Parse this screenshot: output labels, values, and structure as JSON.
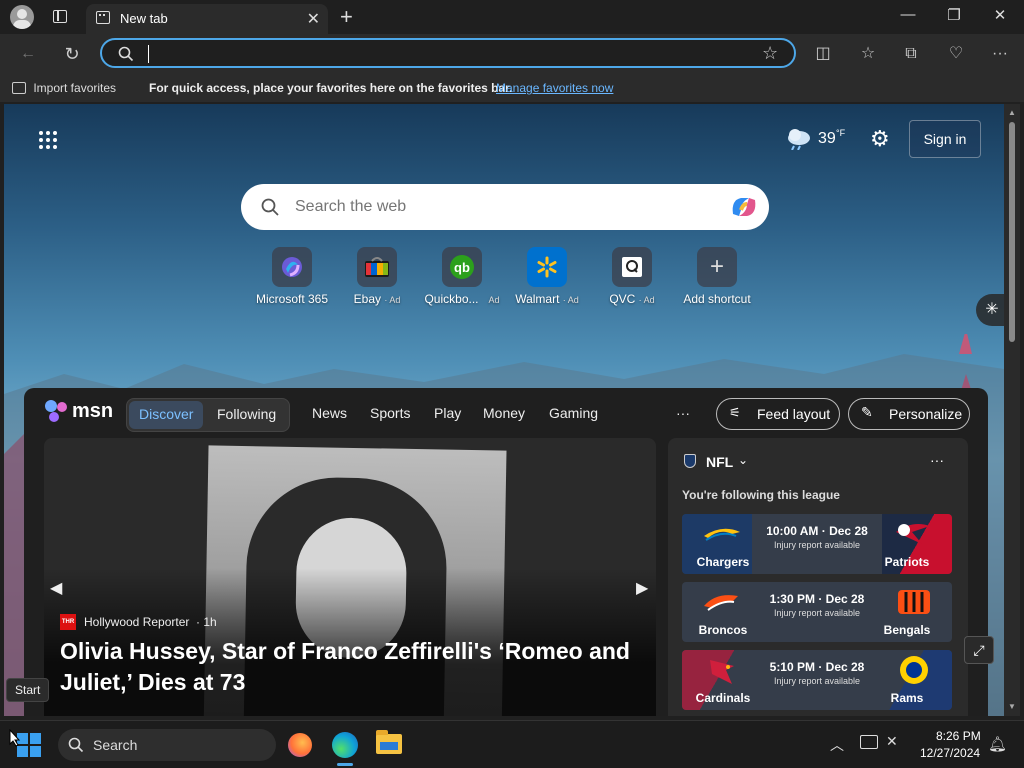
{
  "browser": {
    "tab_title": "New tab",
    "address_value": "",
    "favorites_hint": "For quick access, place your favorites here on the favorites bar.",
    "import_favorites": "Import favorites",
    "manage_favorites": "Manage favorites now"
  },
  "newtab": {
    "weather_temp": "39",
    "weather_unit": "°F",
    "sign_in": "Sign in",
    "search_placeholder": "Search the web",
    "shortcuts": [
      {
        "label": "Microsoft 365",
        "ad": ""
      },
      {
        "label": "Ebay",
        "ad": "· Ad"
      },
      {
        "label": "Quickbo...",
        "ad": "Ad"
      },
      {
        "label": "Walmart",
        "ad": "· Ad"
      },
      {
        "label": "QVC",
        "ad": "· Ad"
      },
      {
        "label": "Add shortcut",
        "ad": ""
      }
    ]
  },
  "feed": {
    "brand": "msn",
    "tabs": [
      "Discover",
      "Following",
      "News",
      "Sports",
      "Play",
      "Money",
      "Gaming"
    ],
    "more": "···",
    "feed_layout": "Feed layout",
    "personalize": "Personalize",
    "hero": {
      "source": "Hollywood Reporter",
      "source_badge": "THR",
      "age": "· 1h",
      "headline": "Olivia Hussey, Star of Franco Zeffirelli's ‘Romeo and Juliet,’ Dies at 73"
    },
    "nfl": {
      "title": "NFL",
      "subtitle": "You're following this league",
      "more": "···",
      "games": [
        {
          "home": "Chargers",
          "away": "Patriots",
          "time": "10:00 AM · Dec 28",
          "status": "Injury report available",
          "home_color": "#1d3a66",
          "away_color": "#c8102e"
        },
        {
          "home": "Broncos",
          "away": "Bengals",
          "time": "1:30 PM · Dec 28",
          "status": "Injury report available",
          "home_color": "#1e2a44",
          "away_color": "#1e2a44"
        },
        {
          "home": "Cardinals",
          "away": "Rams",
          "time": "5:10 PM · Dec 28",
          "status": "Injury report available",
          "home_color": "#97233f",
          "away_color": "#1e3a72"
        }
      ]
    }
  },
  "tooltip": "Start",
  "taskbar": {
    "search_label": "Search",
    "time": "8:26 PM",
    "date": "12/27/2024"
  },
  "colors": {
    "accent": "#4da7e8",
    "link": "#6ab7ff"
  }
}
